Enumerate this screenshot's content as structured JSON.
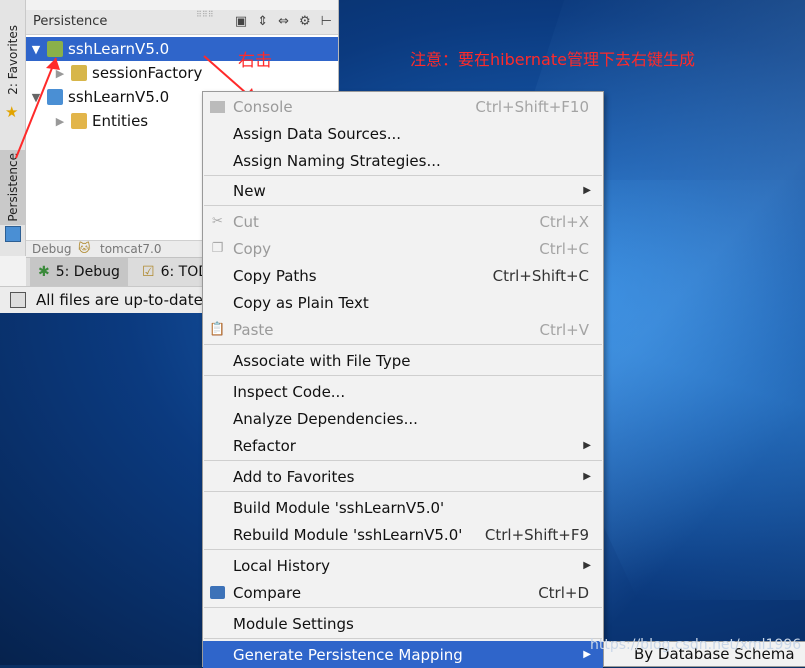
{
  "ide": {
    "stripe_tabs": {
      "favorites": "2: Favorites",
      "persistence": "Persistence"
    },
    "panel_title": "Persistence",
    "tree": [
      {
        "label": "sshLearnV5.0",
        "expanded": true,
        "selected": true
      },
      {
        "label": "sessionFactory"
      },
      {
        "label": "sshLearnV5.0",
        "expanded": true
      },
      {
        "label": "Entities"
      }
    ],
    "debugbar": {
      "label": "Debug",
      "config": "tomcat7.0"
    },
    "bottom_tabs": [
      "5: Debug",
      "6: TOD"
    ],
    "status_text": "All files are up-to-date"
  },
  "annotations": {
    "right_click": "右击",
    "note": "注意：要在hibernate管理下去右键生成"
  },
  "context_menu": {
    "items": [
      {
        "label": "Console",
        "shortcut": "Ctrl+Shift+F10",
        "disabled": true
      },
      {
        "label": "Assign Data Sources..."
      },
      {
        "label": "Assign Naming Strategies..."
      },
      {
        "label": "New",
        "submenu": true
      },
      {
        "label": "Cut",
        "shortcut": "Ctrl+X",
        "disabled": true
      },
      {
        "label": "Copy",
        "shortcut": "Ctrl+C",
        "disabled": true
      },
      {
        "label": "Copy Paths",
        "shortcut": "Ctrl+Shift+C"
      },
      {
        "label": "Copy as Plain Text"
      },
      {
        "label": "Paste",
        "shortcut": "Ctrl+V",
        "disabled": true
      },
      {
        "label": "Associate with File Type"
      },
      {
        "label": "Inspect Code..."
      },
      {
        "label": "Analyze Dependencies..."
      },
      {
        "label": "Refactor",
        "submenu": true
      },
      {
        "label": "Add to Favorites",
        "submenu": true
      },
      {
        "label": "Build Module 'sshLearnV5.0'"
      },
      {
        "label": "Rebuild Module 'sshLearnV5.0'",
        "shortcut": "Ctrl+Shift+F9"
      },
      {
        "label": "Local History",
        "submenu": true
      },
      {
        "label": "Compare",
        "shortcut": "Ctrl+D"
      },
      {
        "label": "Module Settings"
      },
      {
        "label": "Generate Persistence Mapping",
        "submenu": true,
        "highlighted": true
      }
    ],
    "submenu_item": "By Database Schema"
  },
  "watermark": "https://blog.csdn.net/xml1996",
  "colors": {
    "selection": "#2f65ca",
    "annotation": "#ff2a2a"
  }
}
